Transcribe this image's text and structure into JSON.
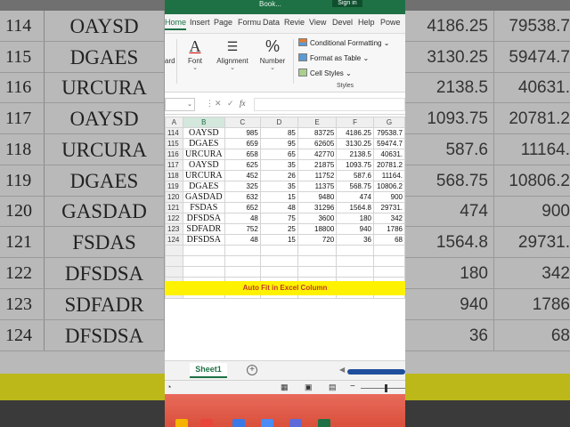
{
  "window": {
    "title": "Book...",
    "sign_in": "Sign in"
  },
  "tabs": [
    {
      "label": "Home",
      "active": true
    },
    {
      "label": "Insert"
    },
    {
      "label": "Page"
    },
    {
      "label": "Formu"
    },
    {
      "label": "Data"
    },
    {
      "label": "Revie"
    },
    {
      "label": "View"
    },
    {
      "label": "Devel"
    },
    {
      "label": "Help"
    },
    {
      "label": "Powe"
    }
  ],
  "ribbon": {
    "clipboard_partial": "ard",
    "font_label": "Font",
    "alignment_label": "Alignment",
    "number_label": "Number",
    "conditional_formatting": "Conditional Formatting",
    "format_as_table": "Format as Table",
    "cell_styles": "Cell Styles",
    "styles_group": "Styles"
  },
  "formula_bar": {
    "fx": "fx"
  },
  "columns": [
    "A",
    "B",
    "C",
    "D",
    "E",
    "F",
    "G"
  ],
  "rows": [
    {
      "row": "114",
      "name": "OAYSD",
      "c": "985",
      "d": "85",
      "e": "83725",
      "f": "4186.25",
      "g": "79538.7"
    },
    {
      "row": "115",
      "name": "DGAES",
      "c": "659",
      "d": "95",
      "e": "62605",
      "f": "3130.25",
      "g": "59474.7"
    },
    {
      "row": "116",
      "name": "URCURA",
      "c": "658",
      "d": "65",
      "e": "42770",
      "f": "2138.5",
      "g": "40631."
    },
    {
      "row": "117",
      "name": "OAYSD",
      "c": "625",
      "d": "35",
      "e": "21875",
      "f": "1093.75",
      "g": "20781.2"
    },
    {
      "row": "118",
      "name": "URCURA",
      "c": "452",
      "d": "26",
      "e": "11752",
      "f": "587.6",
      "g": "11164."
    },
    {
      "row": "119",
      "name": "DGAES",
      "c": "325",
      "d": "35",
      "e": "11375",
      "f": "568.75",
      "g": "10806.2"
    },
    {
      "row": "120",
      "name": "GASDAD",
      "c": "632",
      "d": "15",
      "e": "9480",
      "f": "474",
      "g": "900"
    },
    {
      "row": "121",
      "name": "FSDAS",
      "c": "652",
      "d": "48",
      "e": "31296",
      "f": "1564.8",
      "g": "29731."
    },
    {
      "row": "122",
      "name": "DFSDSA",
      "c": "48",
      "d": "75",
      "e": "3600",
      "f": "180",
      "g": "342"
    },
    {
      "row": "123",
      "name": "SDFADR",
      "c": "752",
      "d": "25",
      "e": "18800",
      "f": "940",
      "g": "1786"
    },
    {
      "row": "124",
      "name": "DFSDSA",
      "c": "48",
      "d": "15",
      "e": "720",
      "f": "36",
      "g": "68"
    }
  ],
  "banner": "Auto Fit in Excel Column",
  "sheet": {
    "name": "Sheet1"
  },
  "background": {
    "rows": [
      {
        "row": "114",
        "name": "OAYSD",
        "f": "4186.25",
        "g": "79538.7"
      },
      {
        "row": "115",
        "name": "DGAES",
        "f": "3130.25",
        "g": "59474.7"
      },
      {
        "row": "116",
        "name": "URCURA",
        "f": "2138.5",
        "g": "40631."
      },
      {
        "row": "117",
        "name": "OAYSD",
        "f": "1093.75",
        "g": "20781.2"
      },
      {
        "row": "118",
        "name": "URCURA",
        "f": "587.6",
        "g": "11164."
      },
      {
        "row": "119",
        "name": "DGAES",
        "f": "568.75",
        "g": "10806.2"
      },
      {
        "row": "120",
        "name": "GASDAD",
        "f": "474",
        "g": "900"
      },
      {
        "row": "121",
        "name": "FSDAS",
        "f": "1564.8",
        "g": "29731."
      },
      {
        "row": "122",
        "name": "DFSDSA",
        "f": "180",
        "g": "342"
      },
      {
        "row": "123",
        "name": "SDFADR",
        "f": "940",
        "g": "1786"
      },
      {
        "row": "124",
        "name": "DFSDSA",
        "f": "36",
        "g": "68"
      }
    ]
  },
  "colors": {
    "excel_green": "#1e7145",
    "banner_yellow": "#fff200",
    "banner_text": "#c0392b"
  }
}
